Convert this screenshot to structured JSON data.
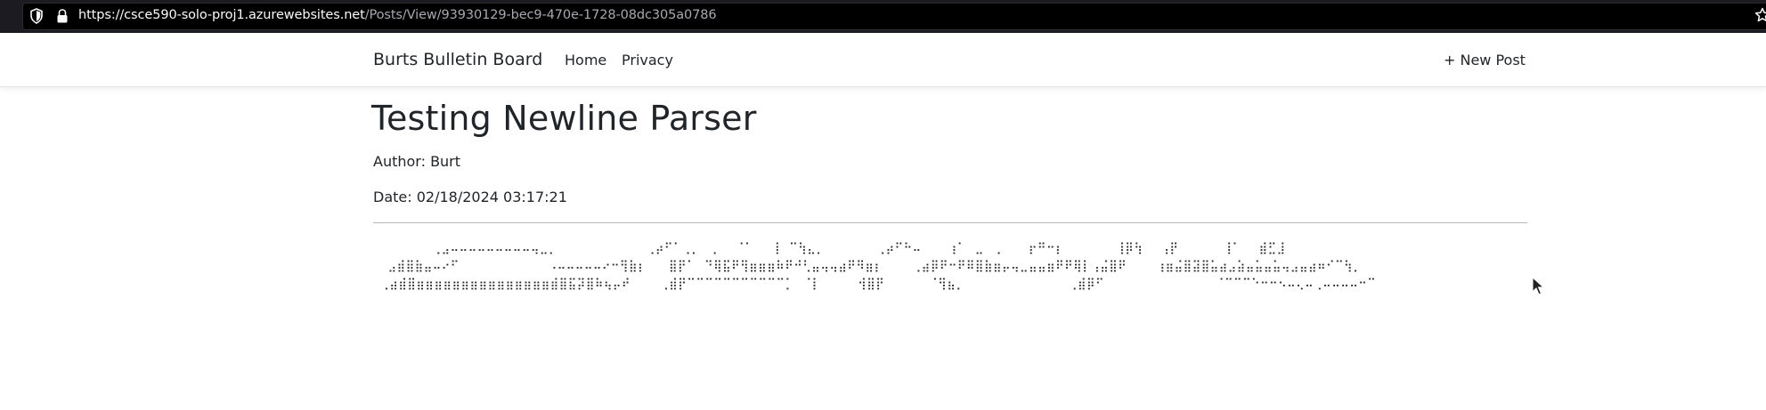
{
  "browser": {
    "url_host": "https://csce590-solo-proj1.azurewebsites.net",
    "url_path": "/Posts/View/93930129-bec9-470e-1728-08dc305a0786",
    "icons": [
      "shield-icon",
      "lock-icon",
      "star-icon"
    ]
  },
  "navbar": {
    "brand": "Burts Bulletin Board",
    "links": {
      "home": "Home",
      "privacy": "Privacy",
      "new_post": "+ New Post"
    }
  },
  "post": {
    "title": "Testing Newline Parser",
    "author": "Author: Burt",
    "date": "Date: 02/18/2024 03:17:21",
    "body_art": "        ⢀⣠⠤⠤⠤⠤⠤⠤⠤⠤⠤⢤⣀⡀            ⢀⡴⠋⠁⢀⡀⠀⢀⠀⠀⠈⠁⠀⠀⢸⠀⠉⢳⣄⡀       ⢀⡴⠋⠓⠤⠀⠀⠀⢰⠁⠀⣀⠀⢀⠀⠀⠀⡖⠛⠒⡆       ⢸⡿⢳⠀⠀⢠⡟⠀⠀⠀⠀⠀⢸⠁⠀⠀⣾⣋⣸⠀\n  ⣠⣾⣿⣷⣤⠤⠔⠋            ⠠⠤⠤⠤⠤⠤⠔⠒⢻⣷⡆   ⣿⡟⠁⠀⠙⢿⣯⠟⢻⣶⣶⣶⠷⠟⠚⢃⣤⢤⢤⣴⠟⠻⣶⡆    ⢀⣴⡿⠟⠒⠟⠿⣿⣷⣶⡤⢤⣀⣤⣤⣶⠟⠟⢿⡇⢠⣬⣿⠟    ⢰⣶⣬⣿⣽⣿⣥⣴⣠⣵⣤⣥⣤⣥⢤⣠⣤⣴⠶⠊⠉⢳⡀\n ⢀⣴⣾⣿⣶⣶⣶⣶⣶⣶⣶⣶⣶⣶⣶⣶⣶⣶⣶⣾⣿⣯⡽⣿⠷⢦⡤⠞    ⢀⣾⡟⠉⠉⠉⠉⠉⠉⠉⠉⠉⠉⠉⡁⠀⠈⡇     ⢺⣿⡟      ⠈⢻⣦⡀              ⢀⣾⡿⠋               ⠈⠉⠉⠉⠑⠒⠒⠢⠤⢄⠤⢀⠤⠤⠤⠤⠒⠉"
  }
}
